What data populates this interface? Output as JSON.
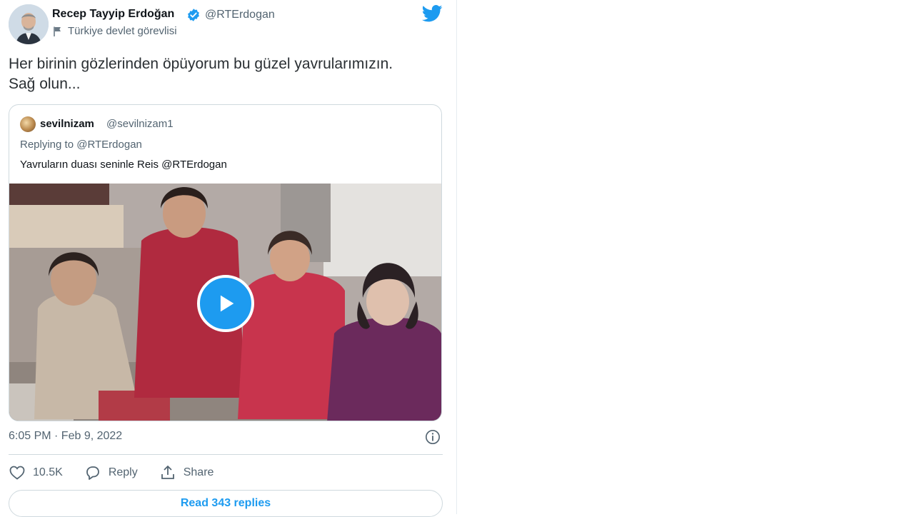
{
  "tweet": {
    "author": {
      "name": "Recep Tayyip Erdoğan",
      "handle": "@RTErdogan",
      "label": "Türkiye devlet görevlisi",
      "avatar_icon": "profile-photo",
      "verified_icon": "verified-badge-icon"
    },
    "text_line1": "Her birinin gözlerinden öpüyorum bu güzel yavrularımızın.",
    "text_line2": "Sağ olun...",
    "timestamp": "6:05 PM · Feb 9, 2022",
    "likes": "10.5K",
    "reply_label": "Reply",
    "share_label": "Share",
    "read_replies": "Read 343 replies"
  },
  "quoted_tweet": {
    "name": "sevilnizam",
    "handle": "@sevilnizam1",
    "replying_to": "Replying to @RTErdogan",
    "text": "Yavruların duası seninle Reis @RTErdogan",
    "media_type": "video"
  },
  "colors": {
    "accent": "#1d9bf0",
    "text_primary": "#0f1419",
    "text_secondary": "#536471",
    "border": "#cfd9de"
  }
}
